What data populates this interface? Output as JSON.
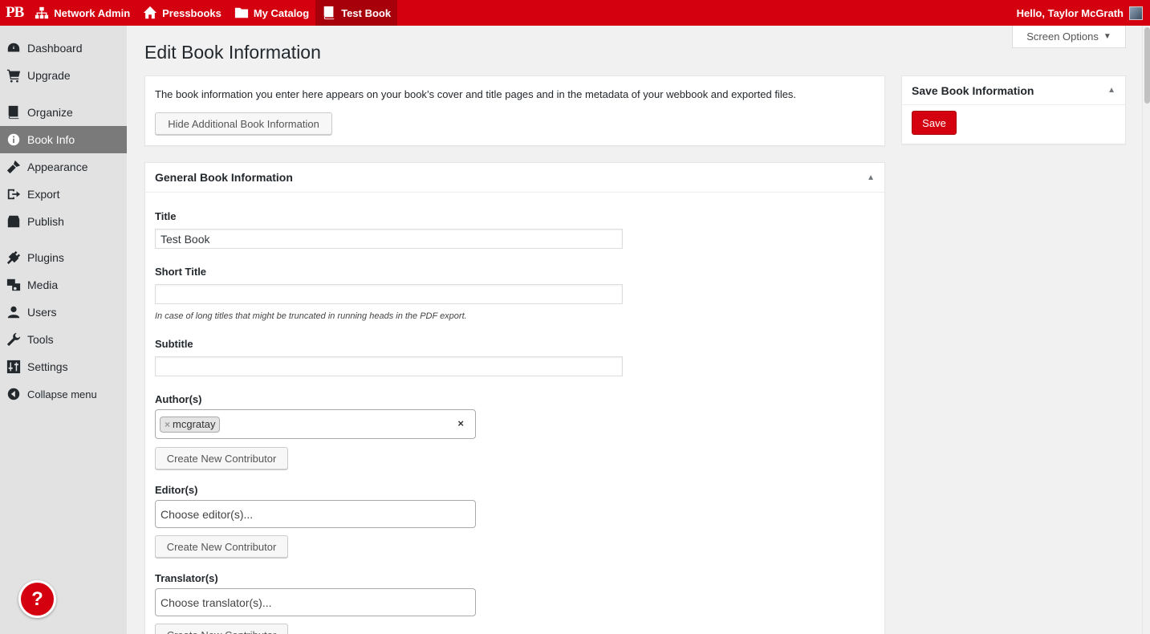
{
  "adminbar": {
    "logo": "PB",
    "items": [
      {
        "label": "Network Admin",
        "icon": "network-icon"
      },
      {
        "label": "Pressbooks",
        "icon": "home-icon"
      },
      {
        "label": "My Catalog",
        "icon": "folder-icon"
      },
      {
        "label": "Test Book",
        "icon": "book-icon"
      }
    ],
    "greeting": "Hello, Taylor McGrath"
  },
  "sidebar": {
    "items": [
      {
        "label": "Dashboard",
        "icon": "dashboard-icon"
      },
      {
        "label": "Upgrade",
        "icon": "cart-icon"
      },
      {
        "label": "Organize",
        "icon": "book-icon"
      },
      {
        "label": "Book Info",
        "icon": "info-icon"
      },
      {
        "label": "Appearance",
        "icon": "brush-icon"
      },
      {
        "label": "Export",
        "icon": "export-icon"
      },
      {
        "label": "Publish",
        "icon": "store-icon"
      },
      {
        "label": "Plugins",
        "icon": "plugin-icon"
      },
      {
        "label": "Media",
        "icon": "media-icon"
      },
      {
        "label": "Users",
        "icon": "user-icon"
      },
      {
        "label": "Tools",
        "icon": "wrench-icon"
      },
      {
        "label": "Settings",
        "icon": "settings-icon"
      },
      {
        "label": "Collapse menu",
        "icon": "collapse-icon"
      }
    ],
    "current": "Book Info",
    "help_label": "?"
  },
  "screen_options": {
    "label": "Screen Options"
  },
  "page": {
    "title": "Edit Book Information",
    "intro_text": "The book information you enter here appears on your book’s cover and title pages and in the metadata of your webbook and exported files.",
    "hide_button": "Hide Additional Book Information"
  },
  "save_box": {
    "title": "Save Book Information",
    "save_label": "Save"
  },
  "general": {
    "title": "General Book Information",
    "title_label": "Title",
    "title_value": "Test Book",
    "short_title_label": "Short Title",
    "short_title_value": "",
    "short_title_hint": "In case of long titles that might be truncated in running heads in the PDF export.",
    "subtitle_label": "Subtitle",
    "subtitle_value": "",
    "authors_label": "Author(s)",
    "authors": [
      "mcgratay"
    ],
    "create_contributor": "Create New Contributor",
    "editors_label": "Editor(s)",
    "editors_placeholder": "Choose editor(s)...",
    "translators_label": "Translator(s)",
    "translators_placeholder": "Choose translator(s)..."
  },
  "colors": {
    "brand": "#d4000f",
    "brand_dark": "#a8000b",
    "sidebar": "#e2e2e2",
    "sidebar_current": "#7a7a7a"
  }
}
